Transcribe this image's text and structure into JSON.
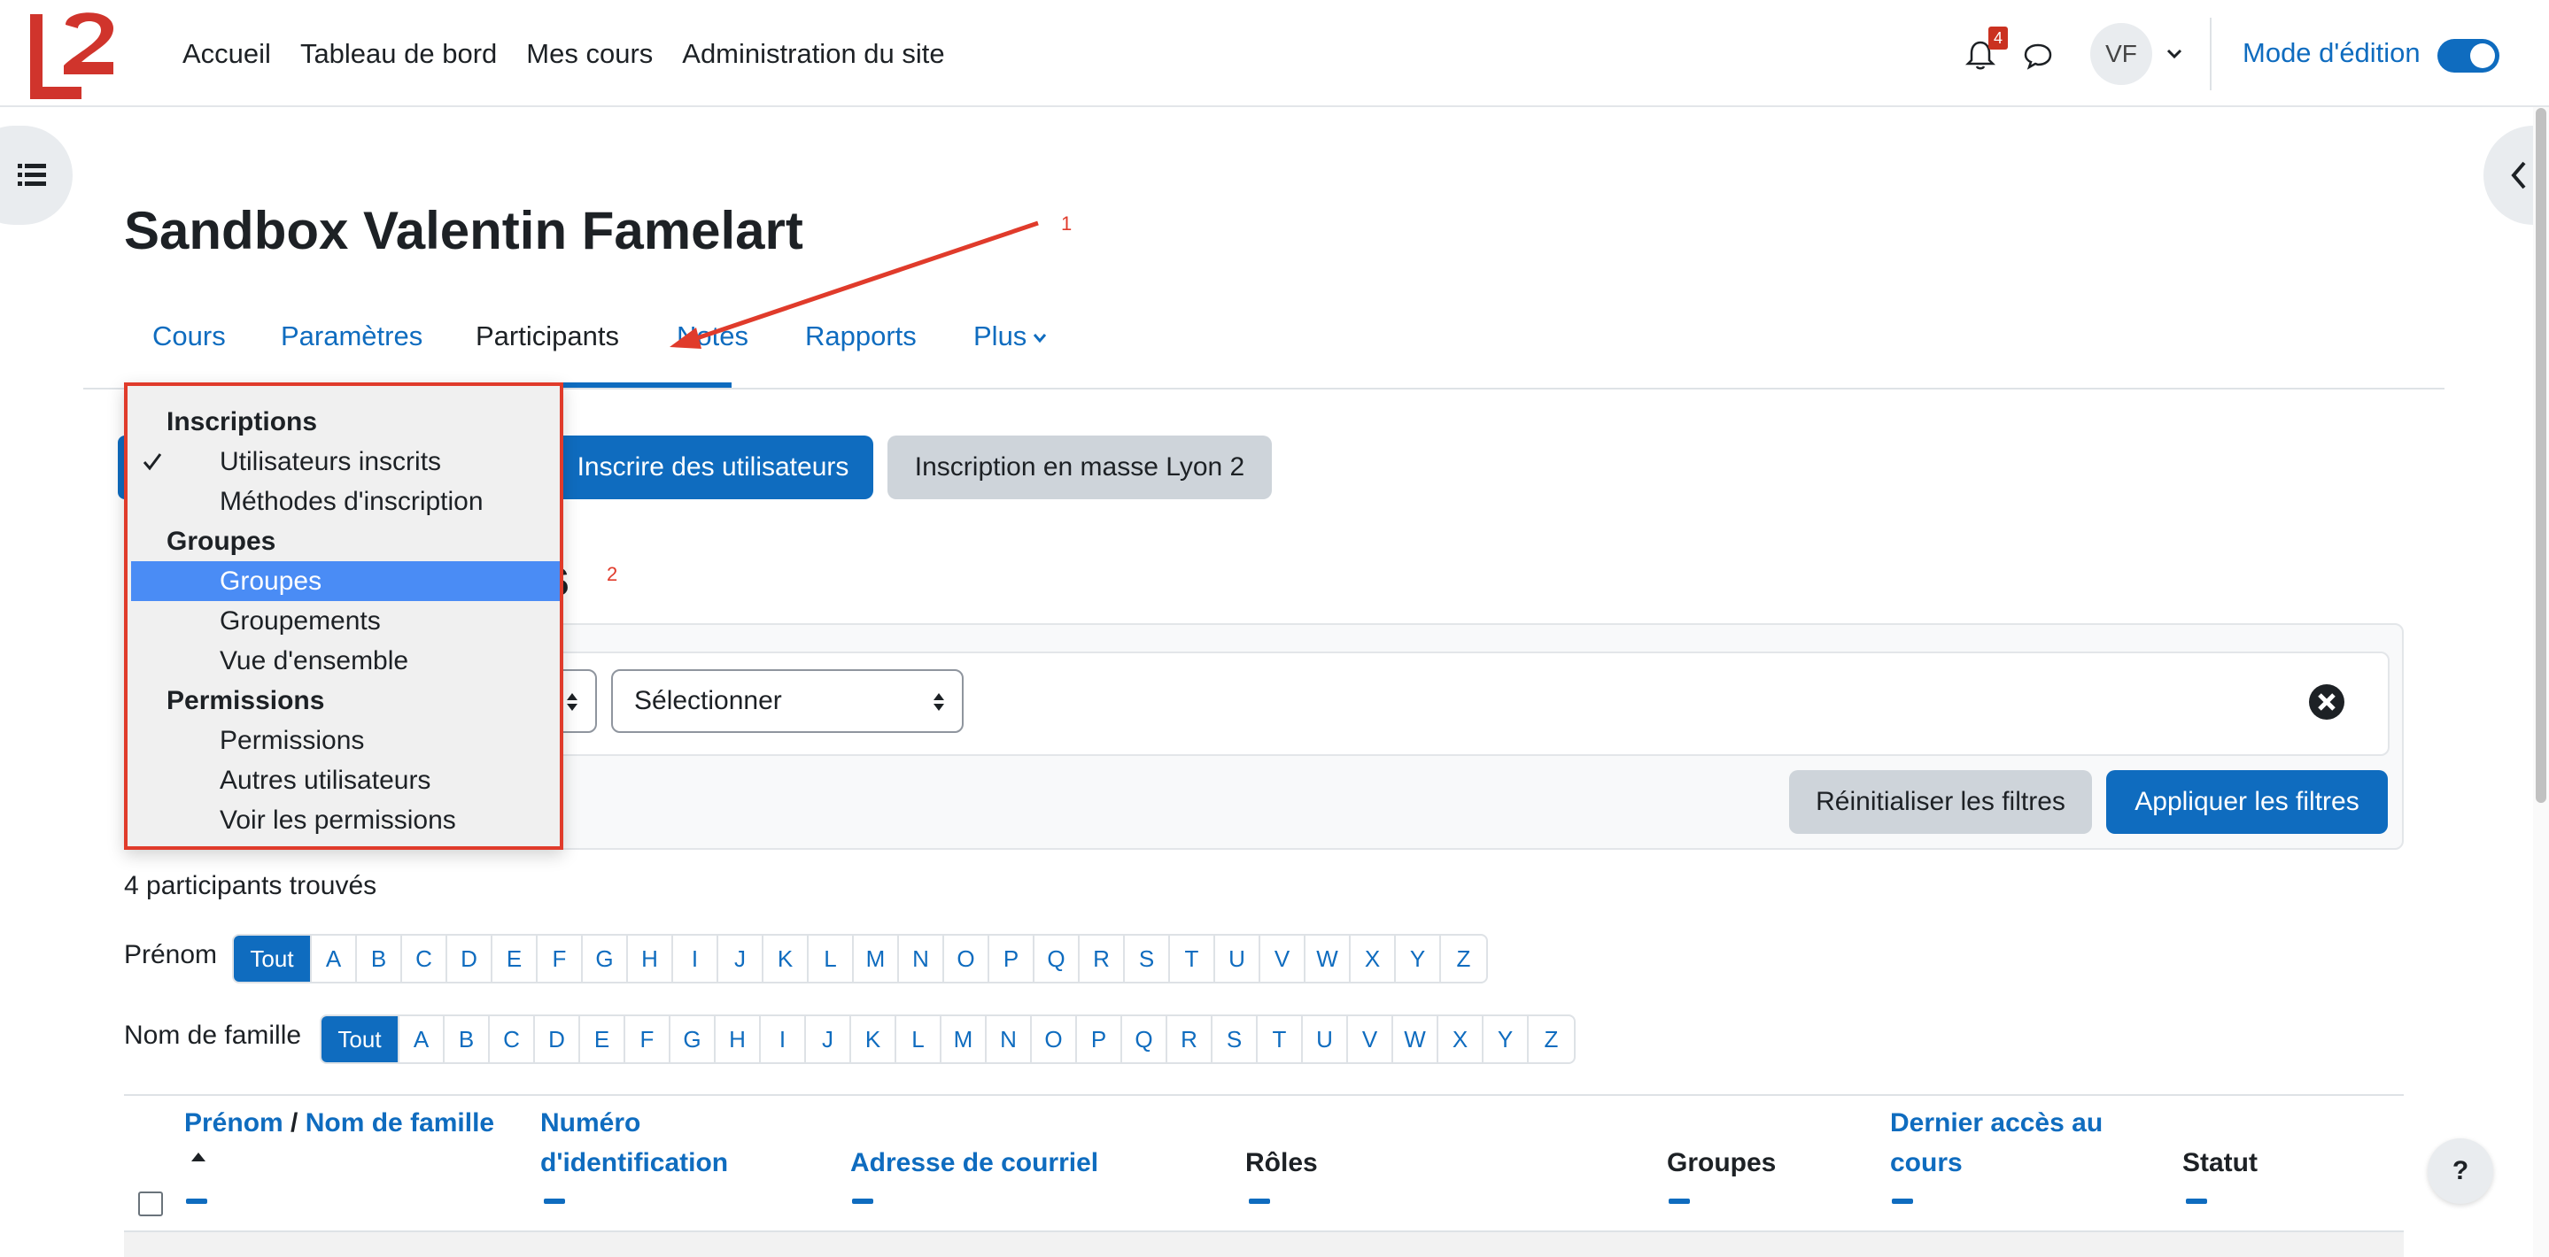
{
  "navbar": {
    "links": [
      "Accueil",
      "Tableau de bord",
      "Mes cours",
      "Administration du site"
    ],
    "notifications_count": "4",
    "avatar_initials": "VF",
    "edit_mode_label": "Mode d'édition",
    "edit_mode_on": true
  },
  "page": {
    "title": "Sandbox Valentin Famelart",
    "section_heading_partial": "ts"
  },
  "secondary_nav": {
    "tabs": [
      "Cours",
      "Paramètres",
      "Participants",
      "Notes",
      "Rapports",
      "Plus"
    ],
    "active": "Participants"
  },
  "actions": {
    "enrol_button": "Inscrire des utilisateurs",
    "bulk_button": "Inscription en masse Lyon 2"
  },
  "filters": {
    "select_placeholder": "Sélectionner",
    "reset_button": "Réinitialiser les filtres",
    "apply_button": "Appliquer les filtres"
  },
  "participants": {
    "count_text": "4 participants trouvés",
    "firstname_label": "Prénom",
    "lastname_label": "Nom de famille",
    "all_label": "Tout",
    "letters": [
      "A",
      "B",
      "C",
      "D",
      "E",
      "F",
      "G",
      "H",
      "I",
      "J",
      "K",
      "L",
      "M",
      "N",
      "O",
      "P",
      "Q",
      "R",
      "S",
      "T",
      "U",
      "V",
      "W",
      "X",
      "Y",
      "Z"
    ]
  },
  "table": {
    "headers": {
      "firstname": "Prénom",
      "separator": "/",
      "lastname": "Nom de famille",
      "idnumber_line1": "Numéro",
      "idnumber_line2": "d'identification",
      "email": "Adresse de courriel",
      "roles": "Rôles",
      "groups": "Groupes",
      "lastaccess_line1": "Dernier accès au",
      "lastaccess_line2": "cours",
      "status": "Statut"
    }
  },
  "dropdown": {
    "items": [
      {
        "label": "Inscriptions",
        "type": "group"
      },
      {
        "label": "Utilisateurs inscrits",
        "type": "option",
        "checked": true
      },
      {
        "label": "Méthodes d'inscription",
        "type": "option"
      },
      {
        "label": "Groupes",
        "type": "group"
      },
      {
        "label": "Groupes",
        "type": "option",
        "highlighted": true
      },
      {
        "label": "Groupements",
        "type": "option"
      },
      {
        "label": "Vue d'ensemble",
        "type": "option"
      },
      {
        "label": "Permissions",
        "type": "group"
      },
      {
        "label": "Permissions",
        "type": "option"
      },
      {
        "label": "Autres utilisateurs",
        "type": "option"
      },
      {
        "label": "Voir les permissions",
        "type": "option"
      }
    ]
  },
  "annotations": {
    "marker_1": "1",
    "marker_2": "2"
  },
  "help_label": "?",
  "colors": {
    "brand": "#0f6cbf",
    "annotation_red": "#e03b2b",
    "logo_red": "#d0342c",
    "highlight": "#4a8cf5"
  },
  "icons": [
    "bell-icon",
    "chat-icon",
    "chevron-down-icon",
    "list-icon",
    "chevron-left-icon",
    "close-circle-icon",
    "checkmark-icon",
    "sort-up-icon",
    "help-icon"
  ]
}
